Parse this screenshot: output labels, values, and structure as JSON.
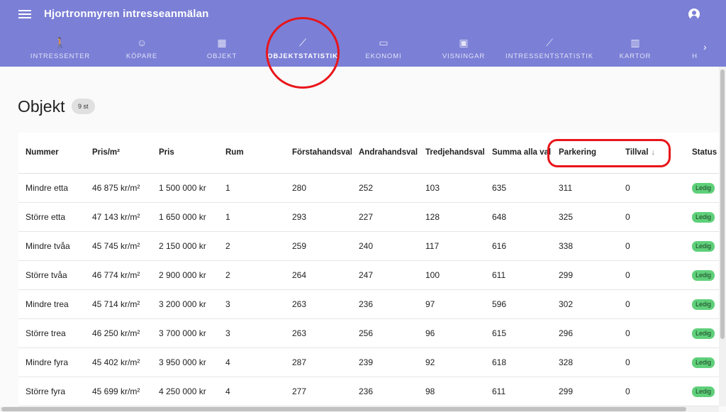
{
  "app": {
    "title": "Hjortronmyren intresseanmälan"
  },
  "tabs": [
    {
      "label": "INTRESSENTER",
      "icon": "person-walk-icon",
      "glyph": "🚶"
    },
    {
      "label": "KÖPARE",
      "icon": "face-icon",
      "glyph": "☺"
    },
    {
      "label": "OBJEKT",
      "icon": "building-icon",
      "glyph": "▦"
    },
    {
      "label": "OBJEKTSTATISTIK",
      "icon": "trending-icon",
      "glyph": "⟋"
    },
    {
      "label": "EKONOMI",
      "icon": "credit-card-icon",
      "glyph": "▭"
    },
    {
      "label": "VISNINGAR",
      "icon": "calendar-icon",
      "glyph": "▣"
    },
    {
      "label": "INTRESSENTSTATISTIK",
      "icon": "trending-icon",
      "glyph": "⟋"
    },
    {
      "label": "KARTOR",
      "icon": "map-icon",
      "glyph": "▥"
    },
    {
      "label": "H",
      "icon": "",
      "glyph": ""
    }
  ],
  "active_tab": "OBJEKTSTATISTIK",
  "page": {
    "title": "Objekt",
    "count": "9 st"
  },
  "table": {
    "headers": {
      "nummer": "Nummer",
      "pris_m2": "Pris/m²",
      "pris": "Pris",
      "rum": "Rum",
      "forsta": "Förstahandsval",
      "andra": "Andrahandsval",
      "tredje": "Tredjehandsval",
      "summa": "Summa alla val",
      "parkering": "Parkering",
      "tillval": "Tillval",
      "status": "Status"
    },
    "rows": [
      [
        "Mindre etta",
        "46 875 kr/m²",
        "1 500 000 kr",
        "1",
        "280",
        "252",
        "103",
        "635",
        "311",
        "0",
        "Ledig"
      ],
      [
        "Större etta",
        "47 143 kr/m²",
        "1 650 000 kr",
        "1",
        "293",
        "227",
        "128",
        "648",
        "325",
        "0",
        "Ledig"
      ],
      [
        "Mindre tvåa",
        "45 745 kr/m²",
        "2 150 000 kr",
        "2",
        "259",
        "240",
        "117",
        "616",
        "338",
        "0",
        "Ledig"
      ],
      [
        "Större tvåa",
        "46 774 kr/m²",
        "2 900 000 kr",
        "2",
        "264",
        "247",
        "100",
        "611",
        "299",
        "0",
        "Ledig"
      ],
      [
        "Mindre trea",
        "45 714 kr/m²",
        "3 200 000 kr",
        "3",
        "263",
        "236",
        "97",
        "596",
        "302",
        "0",
        "Ledig"
      ],
      [
        "Större trea",
        "46 250 kr/m²",
        "3 700 000 kr",
        "3",
        "263",
        "256",
        "96",
        "615",
        "296",
        "0",
        "Ledig"
      ],
      [
        "Mindre fyra",
        "45 402 kr/m²",
        "3 950 000 kr",
        "4",
        "287",
        "239",
        "92",
        "618",
        "328",
        "0",
        "Ledig"
      ],
      [
        "Större fyra",
        "45 699 kr/m²",
        "4 250 000 kr",
        "4",
        "277",
        "236",
        "98",
        "611",
        "299",
        "0",
        "Ledig"
      ]
    ]
  },
  "colors": {
    "appbar": "#7b7fd6",
    "highlight": "#e8151a",
    "status_ledig": "#5fd07a"
  }
}
